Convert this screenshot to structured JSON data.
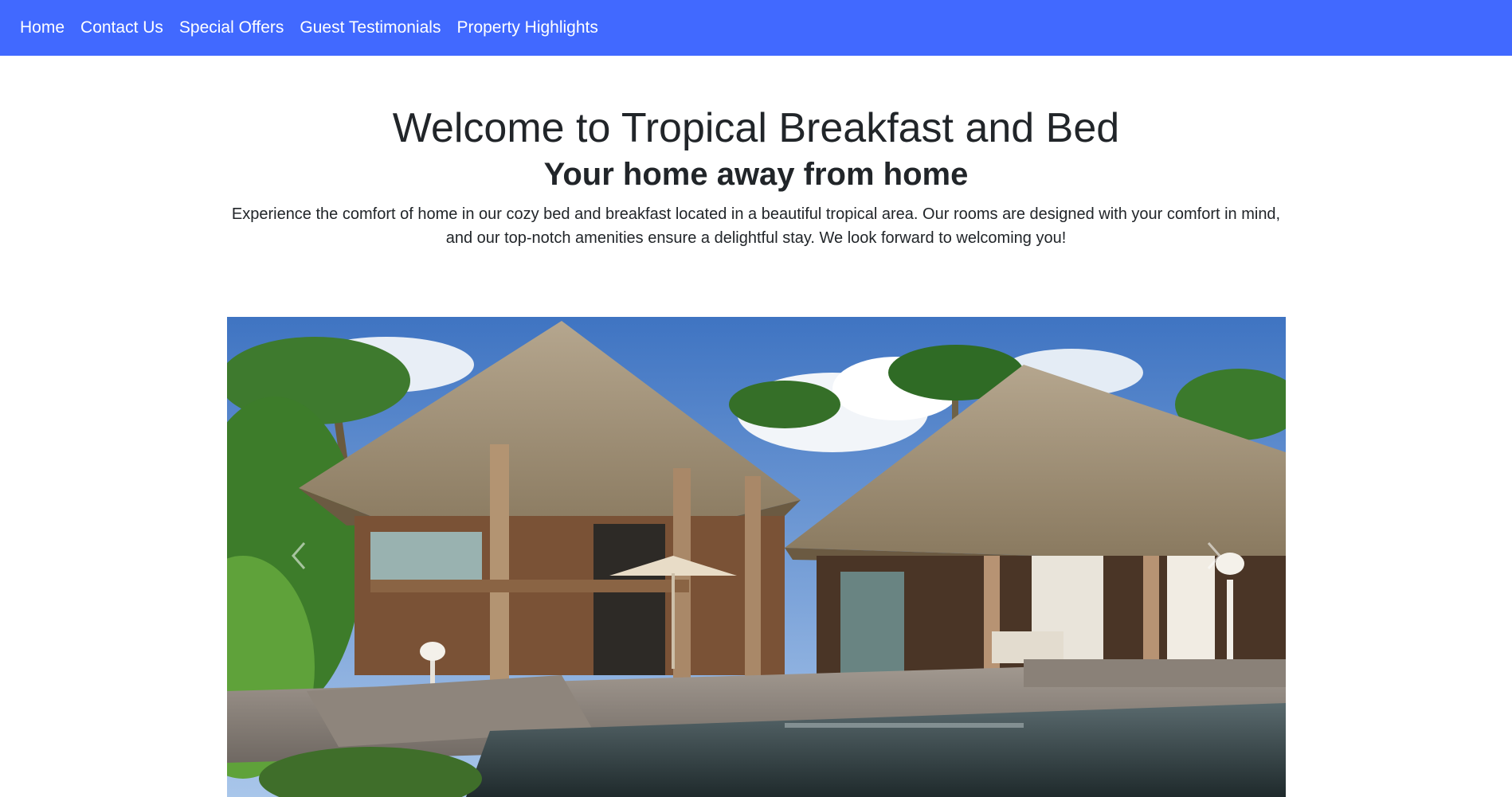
{
  "nav": {
    "items": [
      {
        "label": "Home"
      },
      {
        "label": "Contact Us"
      },
      {
        "label": "Special Offers"
      },
      {
        "label": "Guest Testimonials"
      },
      {
        "label": "Property Highlights"
      }
    ]
  },
  "hero": {
    "title": "Welcome to Tropical Breakfast and Bed",
    "subtitle": "Your home away from home",
    "description": "Experience the comfort of home in our cozy bed and breakfast located in a beautiful tropical area. Our rooms are designed with your comfort in mind, and our top-notch amenities ensure a delightful stay. We look forward to welcoming you!"
  },
  "carousel": {
    "prev_icon": "chevron-left-icon",
    "next_icon": "chevron-right-icon"
  },
  "colors": {
    "navbar": "#4169ff",
    "text": "#212529"
  }
}
